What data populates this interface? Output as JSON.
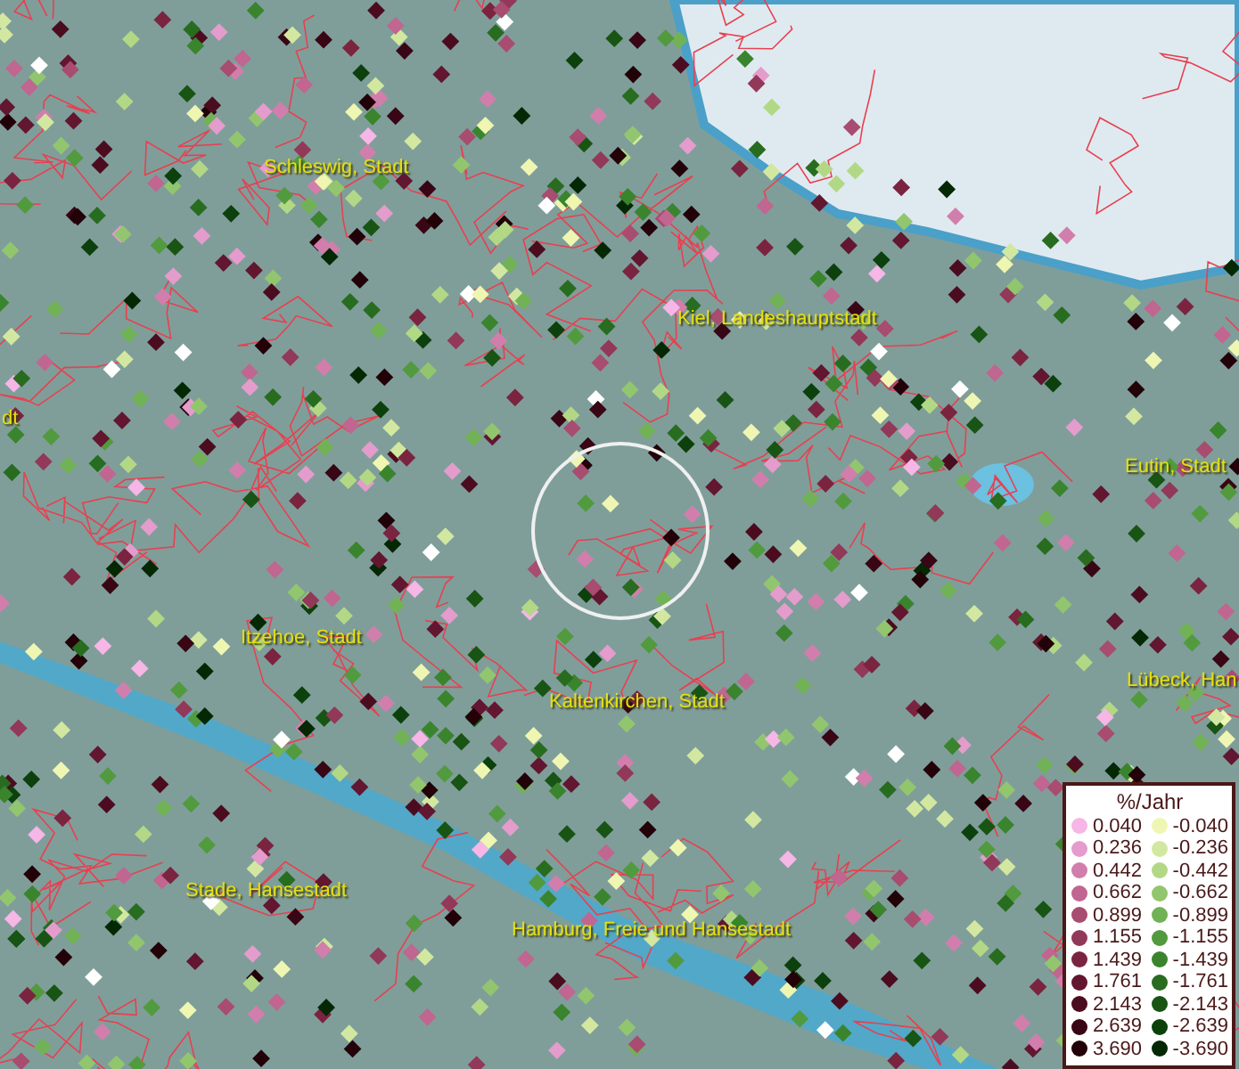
{
  "map": {
    "places": [
      {
        "name": "Schleswig, Stadt"
      },
      {
        "name": "Kiel, Landeshauptstadt"
      },
      {
        "name": "dt"
      },
      {
        "name": "Eutin, Stadt"
      },
      {
        "name": "Itzehoe, Stadt"
      },
      {
        "name": "Lübeck, Han"
      },
      {
        "name": "Kaltenkirchen, Stadt"
      },
      {
        "name": "Stade, Hansestadt"
      },
      {
        "name": "Hamburg, Freie und Hansestadt"
      }
    ]
  },
  "legend": {
    "title": "%/Jahr",
    "positive": [
      {
        "value": "0.040",
        "color": "#f6b6e6"
      },
      {
        "value": "0.236",
        "color": "#e49ccc"
      },
      {
        "value": "0.442",
        "color": "#d27eac"
      },
      {
        "value": "0.662",
        "color": "#c06690"
      },
      {
        "value": "0.899",
        "color": "#a84c70"
      },
      {
        "value": "1.155",
        "color": "#923858"
      },
      {
        "value": "1.439",
        "color": "#7a2440"
      },
      {
        "value": "1.761",
        "color": "#621630"
      },
      {
        "value": "2.143",
        "color": "#4c0c20"
      },
      {
        "value": "2.639",
        "color": "#380614"
      },
      {
        "value": "3.690",
        "color": "#220208"
      }
    ],
    "negative": [
      {
        "value": "-0.040",
        "color": "#eef6b2"
      },
      {
        "value": "-0.236",
        "color": "#d2e8a0"
      },
      {
        "value": "-0.442",
        "color": "#b2d886"
      },
      {
        "value": "-0.662",
        "color": "#92c66e"
      },
      {
        "value": "-0.899",
        "color": "#72b256"
      },
      {
        "value": "-1.155",
        "color": "#529a3e"
      },
      {
        "value": "-1.439",
        "color": "#3a842e"
      },
      {
        "value": "-1.761",
        "color": "#286c20"
      },
      {
        "value": "-2.143",
        "color": "#185414"
      },
      {
        "value": "-2.639",
        "color": "#0c400c"
      },
      {
        "value": "-3.690",
        "color": "#042804"
      }
    ]
  }
}
